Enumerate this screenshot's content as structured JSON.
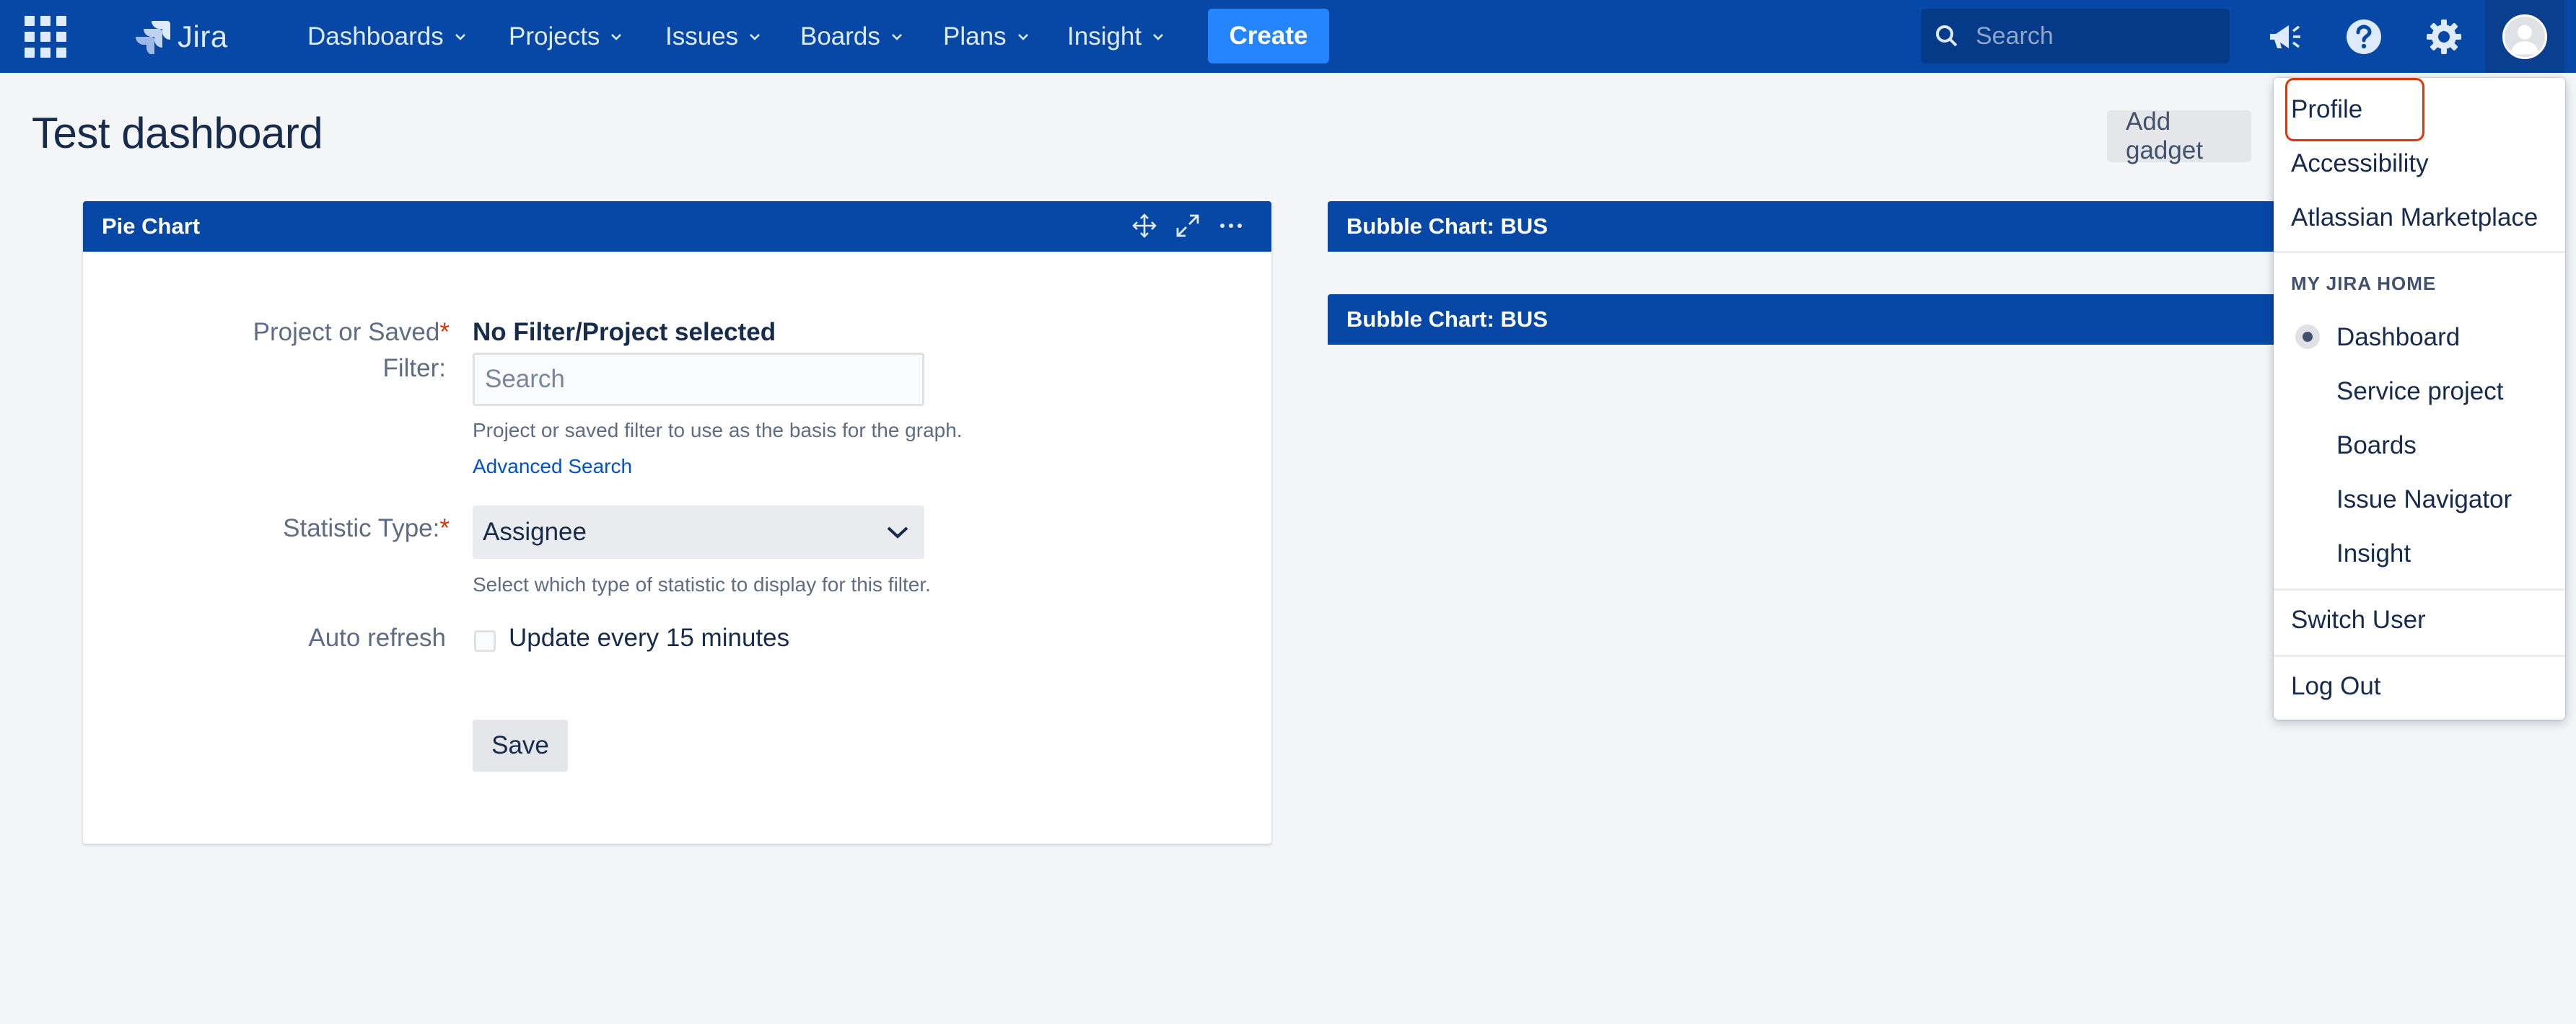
{
  "nav": {
    "logo_text": "Jira",
    "items": [
      "Dashboards",
      "Projects",
      "Issues",
      "Boards",
      "Plans",
      "Insight"
    ],
    "create_label": "Create",
    "search_placeholder": "Search"
  },
  "page": {
    "title": "Test dashboard",
    "add_gadget_label": "Add gadget"
  },
  "gadget": {
    "title": "Pie Chart",
    "filter_label_line1": "Project or Saved",
    "filter_label_line2": "Filter:",
    "required_mark": "*",
    "filter_value": "No Filter/Project selected",
    "filter_placeholder": "Search",
    "filter_help": "Project or saved filter to use as the basis for the graph.",
    "advanced_search": "Advanced Search",
    "statistic_label": "Statistic Type:",
    "statistic_value": "Assignee",
    "statistic_help": "Select which type of statistic to display for this filter.",
    "auto_refresh_label": "Auto refresh",
    "auto_refresh_checkbox": "Update every 15 minutes",
    "save_label": "Save"
  },
  "bubble_charts": [
    "Bubble Chart: BUS",
    "Bubble Chart: BUS"
  ],
  "profile_menu": {
    "items_top": [
      "Profile",
      "Accessibility",
      "Atlassian Marketplace"
    ],
    "heading": "MY JIRA HOME",
    "home_options": [
      "Dashboard",
      "Service project",
      "Boards",
      "Issue Navigator",
      "Insight"
    ],
    "selected_home": "Dashboard",
    "switch_user": "Switch User",
    "log_out": "Log Out"
  },
  "colors": {
    "nav_bg": "#0747a6",
    "create_bg": "#2684ff",
    "link": "#0052cc",
    "required": "#de350b",
    "highlight_ring": "#de350b"
  }
}
